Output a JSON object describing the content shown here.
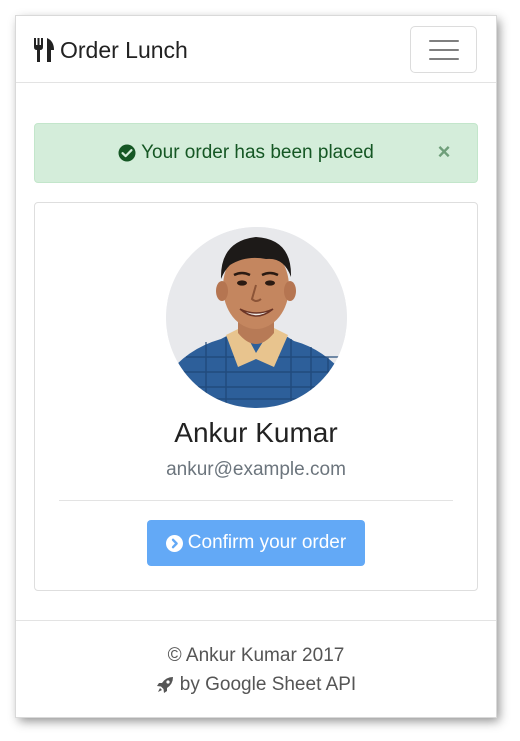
{
  "navbar": {
    "brand_icon": "utensils-icon",
    "brand_label": "Order Lunch",
    "menu_icon": "hamburger-menu-icon"
  },
  "alert": {
    "icon": "check-circle-icon",
    "message": "Your order has been placed",
    "close_label": "×",
    "color": "#d4edda"
  },
  "profile": {
    "avatar_icon": "profile-photo",
    "name": "Ankur Kumar",
    "email": "ankur@example.com"
  },
  "confirm": {
    "icon": "chevron-circle-right-icon",
    "label": "Confirm your order",
    "color": "#63a9f6"
  },
  "footer": {
    "copyright": "© Ankur Kumar 2017",
    "powered_icon": "rocket-icon",
    "powered_label": "by Google Sheet API"
  }
}
